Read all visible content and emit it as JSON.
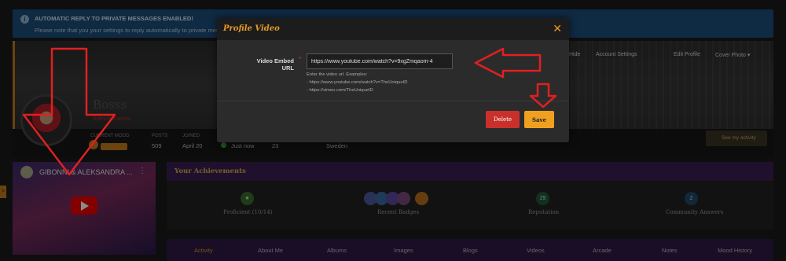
{
  "notice": {
    "title": "AUTOMATIC REPLY TO PRIVATE MESSAGES ENABLED!",
    "text": "Please note that you your settings to reply automatically to private messages",
    "icon": "info-icon"
  },
  "cover_menu": {
    "hide": "Hide",
    "account_settings": "Account Settings",
    "edit_profile": "Edit Profile",
    "cover_photo": "Cover Photo ▾"
  },
  "profile": {
    "username": "Bosss",
    "role": "Administrators",
    "current_mood_label": "CURRENT MOOD",
    "posts_label": "POSTS",
    "posts_value": "509",
    "joined_label": "JOINED",
    "joined_value": "April 20",
    "status_value": "Just now",
    "stat4_value": "23",
    "location_value": "Sweden",
    "see_activity": "See my activity"
  },
  "video": {
    "title": "GIBONNI & ALEKSANDRA ...",
    "more": "⋮"
  },
  "achievements": {
    "header": "Your Achievements",
    "items": [
      {
        "label": "Proficient (10/14)",
        "badge": "★",
        "color": "#3a6e2a"
      },
      {
        "label": "Recent Badges",
        "badge": "",
        "color": "#4a5aa0"
      },
      {
        "label": "Reputation",
        "badge": "29",
        "color": "#1f5a3a"
      },
      {
        "label": "Community Answers",
        "badge": "2",
        "color": "#1f4a6a"
      }
    ]
  },
  "tabs": [
    "Activity",
    "About Me",
    "Albums",
    "Images",
    "Blogs",
    "Videos",
    "Arcade",
    "Notes",
    "Mood History"
  ],
  "side_tab": ">",
  "modal": {
    "title": "Profile Video",
    "close": "✕",
    "field_label": "Video Embed URL",
    "required_mark": "*",
    "input_value": "https://www.youtube.com/watch?v=9xgZmqaom-4",
    "hint_intro": "Enter the video url. Examples:",
    "hint_1": "- https://www.youtube.com/watch?v=TheUniqueID",
    "hint_2": "- https://vimeo.com/TheUniqueID",
    "delete_label": "Delete",
    "save_label": "Save"
  },
  "colors": {
    "accent": "#e39a2a",
    "danger": "#c9302c",
    "annotation": "#e02020",
    "notice": "#1d4e7a"
  }
}
